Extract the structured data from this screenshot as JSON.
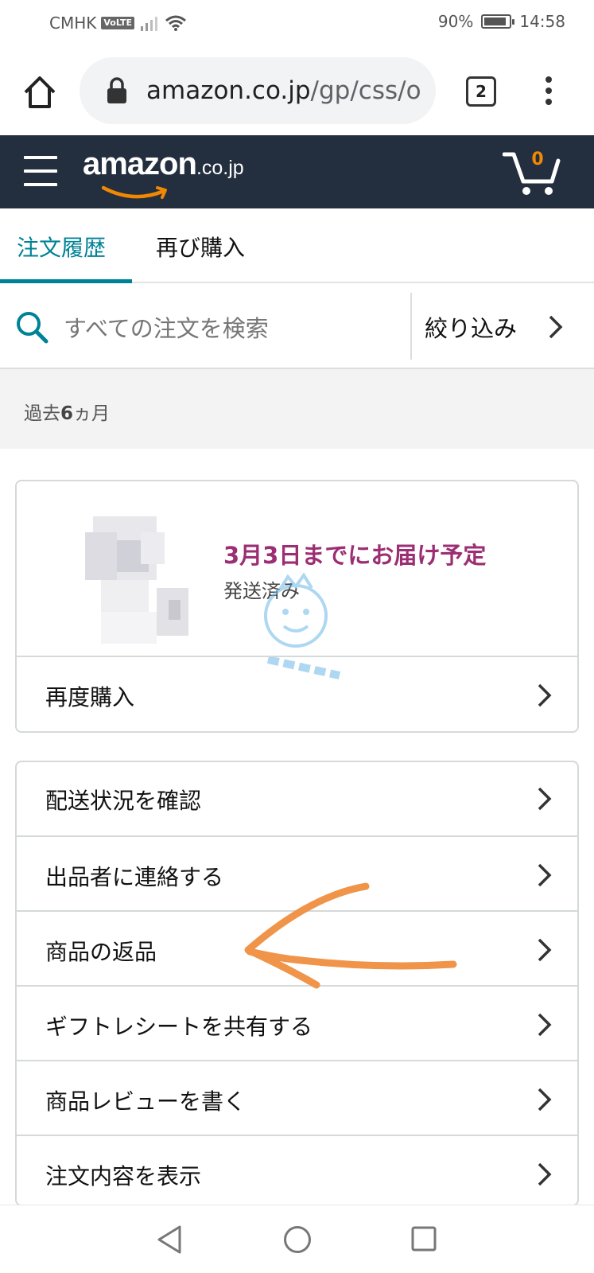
{
  "status_bar": {
    "carrier": "CMHK",
    "volte": "VoLTE",
    "battery_percent": "90%",
    "battery_level": 0.9,
    "time": "14:58",
    "icons": [
      "signal-icon",
      "wifi-icon",
      "battery-icon"
    ]
  },
  "browser": {
    "url_domain": "amazon.co.jp",
    "url_path": "/gp/css/o",
    "tab_count": "2",
    "icons": [
      "home-icon",
      "lock-icon",
      "more-vert-icon"
    ]
  },
  "header": {
    "logo_word": "amazon",
    "logo_tld": ".co.jp",
    "cart_count": "0",
    "bg_color": "#232f3e",
    "accent_color": "#f08804"
  },
  "tabs": [
    {
      "label": "注文履歴",
      "active": true
    },
    {
      "label": "再び購入",
      "active": false
    }
  ],
  "search": {
    "placeholder": "すべての注文を検索",
    "filter_label": "絞り込み"
  },
  "period": {
    "prefix": "過去",
    "number": "6",
    "suffix": "ヵ月"
  },
  "order": {
    "delivery_status": "3月3日までにお届け予定",
    "shipping_status": "発送済み",
    "buy_again_label": "再度購入",
    "delivery_color": "#9c2e73"
  },
  "actions": [
    {
      "label": "配送状況を確認"
    },
    {
      "label": "出品者に連絡する"
    },
    {
      "label": "商品の返品"
    },
    {
      "label": "ギフトレシートを共有する"
    },
    {
      "label": "商品レビューを書く"
    },
    {
      "label": "注文内容を表示"
    }
  ],
  "nav": {
    "icons": [
      "back-icon",
      "home-circle-icon",
      "recent-apps-icon"
    ]
  }
}
